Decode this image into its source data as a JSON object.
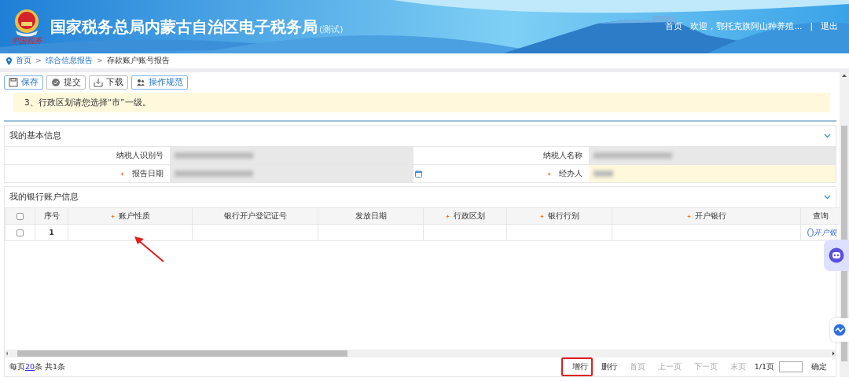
{
  "header": {
    "logo_caption": "中国税务",
    "title": "国家税务总局内蒙古自治区电子税务局",
    "title_suffix": "(测试)",
    "links": [
      "首页",
      "欢迎，鄂托克旗阿山种养殖...",
      "|",
      "退出"
    ]
  },
  "breadcrumb": [
    "首页",
    ">",
    "综合信息报告",
    ">",
    "存款账户账号报告"
  ],
  "toolbar": [
    {
      "kind": "save",
      "label": "保存"
    },
    {
      "kind": "submit",
      "label": "提交"
    },
    {
      "kind": "download",
      "label": "下载"
    },
    {
      "kind": "guide",
      "label": "操作规范"
    }
  ],
  "notice": "3、行政区划请您选择“市”一级。",
  "basic_info": {
    "title": "我的基本信息",
    "expanded": true,
    "fields": [
      {
        "label": "纳税人识别号",
        "required": false,
        "editable": false
      },
      {
        "label": "纳税人名称",
        "required": false,
        "editable": false
      },
      {
        "label": "报告日期",
        "required": true,
        "editable": false,
        "kind": "date"
      },
      {
        "label": "经办人",
        "required": true,
        "editable": true
      }
    ]
  },
  "bank_accounts": {
    "title": "我的银行账户信息",
    "expanded": true,
    "columns": [
      {
        "label": "序号",
        "required": false
      },
      {
        "label": "账户性质",
        "required": true
      },
      {
        "label": "银行开户登记证号",
        "required": false
      },
      {
        "label": "发放日期",
        "required": false
      },
      {
        "label": "行政区划",
        "required": true
      },
      {
        "label": "银行行别",
        "required": true
      },
      {
        "label": "开户银行",
        "required": true
      },
      {
        "label": "查询",
        "required": false
      }
    ],
    "all_checked": false,
    "rows": [
      {
        "checked": false,
        "index": "1",
        "query_link": "开户银"
      }
    ]
  },
  "footer": {
    "per_page_prefix": "每页",
    "per_page": "20",
    "per_page_suffix": "条 共1条",
    "actions": [
      {
        "label": "增行",
        "disabled": false,
        "highlighted": true
      },
      {
        "label": "删行",
        "disabled": false,
        "highlighted": false
      },
      {
        "label": "首页",
        "disabled": true,
        "highlighted": false
      },
      {
        "label": "上一页",
        "disabled": true,
        "highlighted": false
      },
      {
        "label": "下一页",
        "disabled": true,
        "highlighted": false
      },
      {
        "label": "末页",
        "disabled": true,
        "highlighted": false
      }
    ],
    "page_info": "1/1页",
    "confirm": "确定"
  }
}
